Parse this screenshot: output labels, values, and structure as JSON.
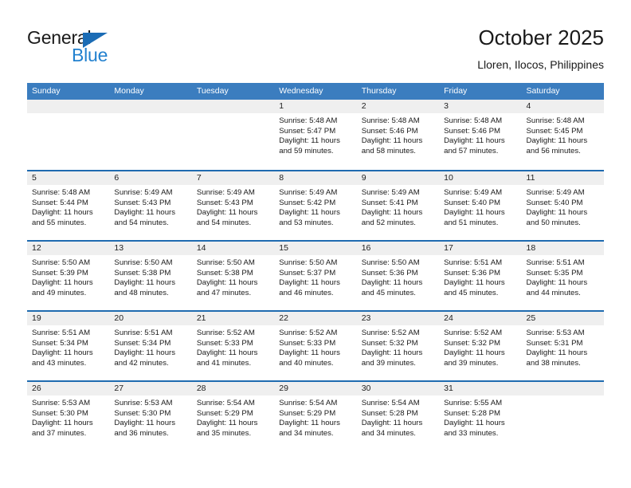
{
  "logo": {
    "word1": "General",
    "word2": "Blue",
    "triangle_color": "#1b6cb5",
    "blue_color": "#2281cf"
  },
  "header": {
    "title": "October 2025",
    "subtitle": "Lloren, Ilocos, Philippines"
  },
  "theme": {
    "header_bar": "#3b7dbf",
    "week_divider": "#1f6bb0",
    "daynum_strip": "#efefef"
  },
  "calendar": {
    "weekday_headers": [
      "Sunday",
      "Monday",
      "Tuesday",
      "Wednesday",
      "Thursday",
      "Friday",
      "Saturday"
    ],
    "weeks": [
      [
        {
          "day": "",
          "sunrise": "",
          "sunset": "",
          "daylight1": "",
          "daylight2": ""
        },
        {
          "day": "",
          "sunrise": "",
          "sunset": "",
          "daylight1": "",
          "daylight2": ""
        },
        {
          "day": "",
          "sunrise": "",
          "sunset": "",
          "daylight1": "",
          "daylight2": ""
        },
        {
          "day": "1",
          "sunrise": "Sunrise: 5:48 AM",
          "sunset": "Sunset: 5:47 PM",
          "daylight1": "Daylight: 11 hours",
          "daylight2": "and 59 minutes."
        },
        {
          "day": "2",
          "sunrise": "Sunrise: 5:48 AM",
          "sunset": "Sunset: 5:46 PM",
          "daylight1": "Daylight: 11 hours",
          "daylight2": "and 58 minutes."
        },
        {
          "day": "3",
          "sunrise": "Sunrise: 5:48 AM",
          "sunset": "Sunset: 5:46 PM",
          "daylight1": "Daylight: 11 hours",
          "daylight2": "and 57 minutes."
        },
        {
          "day": "4",
          "sunrise": "Sunrise: 5:48 AM",
          "sunset": "Sunset: 5:45 PM",
          "daylight1": "Daylight: 11 hours",
          "daylight2": "and 56 minutes."
        }
      ],
      [
        {
          "day": "5",
          "sunrise": "Sunrise: 5:48 AM",
          "sunset": "Sunset: 5:44 PM",
          "daylight1": "Daylight: 11 hours",
          "daylight2": "and 55 minutes."
        },
        {
          "day": "6",
          "sunrise": "Sunrise: 5:49 AM",
          "sunset": "Sunset: 5:43 PM",
          "daylight1": "Daylight: 11 hours",
          "daylight2": "and 54 minutes."
        },
        {
          "day": "7",
          "sunrise": "Sunrise: 5:49 AM",
          "sunset": "Sunset: 5:43 PM",
          "daylight1": "Daylight: 11 hours",
          "daylight2": "and 54 minutes."
        },
        {
          "day": "8",
          "sunrise": "Sunrise: 5:49 AM",
          "sunset": "Sunset: 5:42 PM",
          "daylight1": "Daylight: 11 hours",
          "daylight2": "and 53 minutes."
        },
        {
          "day": "9",
          "sunrise": "Sunrise: 5:49 AM",
          "sunset": "Sunset: 5:41 PM",
          "daylight1": "Daylight: 11 hours",
          "daylight2": "and 52 minutes."
        },
        {
          "day": "10",
          "sunrise": "Sunrise: 5:49 AM",
          "sunset": "Sunset: 5:40 PM",
          "daylight1": "Daylight: 11 hours",
          "daylight2": "and 51 minutes."
        },
        {
          "day": "11",
          "sunrise": "Sunrise: 5:49 AM",
          "sunset": "Sunset: 5:40 PM",
          "daylight1": "Daylight: 11 hours",
          "daylight2": "and 50 minutes."
        }
      ],
      [
        {
          "day": "12",
          "sunrise": "Sunrise: 5:50 AM",
          "sunset": "Sunset: 5:39 PM",
          "daylight1": "Daylight: 11 hours",
          "daylight2": "and 49 minutes."
        },
        {
          "day": "13",
          "sunrise": "Sunrise: 5:50 AM",
          "sunset": "Sunset: 5:38 PM",
          "daylight1": "Daylight: 11 hours",
          "daylight2": "and 48 minutes."
        },
        {
          "day": "14",
          "sunrise": "Sunrise: 5:50 AM",
          "sunset": "Sunset: 5:38 PM",
          "daylight1": "Daylight: 11 hours",
          "daylight2": "and 47 minutes."
        },
        {
          "day": "15",
          "sunrise": "Sunrise: 5:50 AM",
          "sunset": "Sunset: 5:37 PM",
          "daylight1": "Daylight: 11 hours",
          "daylight2": "and 46 minutes."
        },
        {
          "day": "16",
          "sunrise": "Sunrise: 5:50 AM",
          "sunset": "Sunset: 5:36 PM",
          "daylight1": "Daylight: 11 hours",
          "daylight2": "and 45 minutes."
        },
        {
          "day": "17",
          "sunrise": "Sunrise: 5:51 AM",
          "sunset": "Sunset: 5:36 PM",
          "daylight1": "Daylight: 11 hours",
          "daylight2": "and 45 minutes."
        },
        {
          "day": "18",
          "sunrise": "Sunrise: 5:51 AM",
          "sunset": "Sunset: 5:35 PM",
          "daylight1": "Daylight: 11 hours",
          "daylight2": "and 44 minutes."
        }
      ],
      [
        {
          "day": "19",
          "sunrise": "Sunrise: 5:51 AM",
          "sunset": "Sunset: 5:34 PM",
          "daylight1": "Daylight: 11 hours",
          "daylight2": "and 43 minutes."
        },
        {
          "day": "20",
          "sunrise": "Sunrise: 5:51 AM",
          "sunset": "Sunset: 5:34 PM",
          "daylight1": "Daylight: 11 hours",
          "daylight2": "and 42 minutes."
        },
        {
          "day": "21",
          "sunrise": "Sunrise: 5:52 AM",
          "sunset": "Sunset: 5:33 PM",
          "daylight1": "Daylight: 11 hours",
          "daylight2": "and 41 minutes."
        },
        {
          "day": "22",
          "sunrise": "Sunrise: 5:52 AM",
          "sunset": "Sunset: 5:33 PM",
          "daylight1": "Daylight: 11 hours",
          "daylight2": "and 40 minutes."
        },
        {
          "day": "23",
          "sunrise": "Sunrise: 5:52 AM",
          "sunset": "Sunset: 5:32 PM",
          "daylight1": "Daylight: 11 hours",
          "daylight2": "and 39 minutes."
        },
        {
          "day": "24",
          "sunrise": "Sunrise: 5:52 AM",
          "sunset": "Sunset: 5:32 PM",
          "daylight1": "Daylight: 11 hours",
          "daylight2": "and 39 minutes."
        },
        {
          "day": "25",
          "sunrise": "Sunrise: 5:53 AM",
          "sunset": "Sunset: 5:31 PM",
          "daylight1": "Daylight: 11 hours",
          "daylight2": "and 38 minutes."
        }
      ],
      [
        {
          "day": "26",
          "sunrise": "Sunrise: 5:53 AM",
          "sunset": "Sunset: 5:30 PM",
          "daylight1": "Daylight: 11 hours",
          "daylight2": "and 37 minutes."
        },
        {
          "day": "27",
          "sunrise": "Sunrise: 5:53 AM",
          "sunset": "Sunset: 5:30 PM",
          "daylight1": "Daylight: 11 hours",
          "daylight2": "and 36 minutes."
        },
        {
          "day": "28",
          "sunrise": "Sunrise: 5:54 AM",
          "sunset": "Sunset: 5:29 PM",
          "daylight1": "Daylight: 11 hours",
          "daylight2": "and 35 minutes."
        },
        {
          "day": "29",
          "sunrise": "Sunrise: 5:54 AM",
          "sunset": "Sunset: 5:29 PM",
          "daylight1": "Daylight: 11 hours",
          "daylight2": "and 34 minutes."
        },
        {
          "day": "30",
          "sunrise": "Sunrise: 5:54 AM",
          "sunset": "Sunset: 5:28 PM",
          "daylight1": "Daylight: 11 hours",
          "daylight2": "and 34 minutes."
        },
        {
          "day": "31",
          "sunrise": "Sunrise: 5:55 AM",
          "sunset": "Sunset: 5:28 PM",
          "daylight1": "Daylight: 11 hours",
          "daylight2": "and 33 minutes."
        },
        {
          "day": "",
          "sunrise": "",
          "sunset": "",
          "daylight1": "",
          "daylight2": ""
        }
      ]
    ]
  }
}
